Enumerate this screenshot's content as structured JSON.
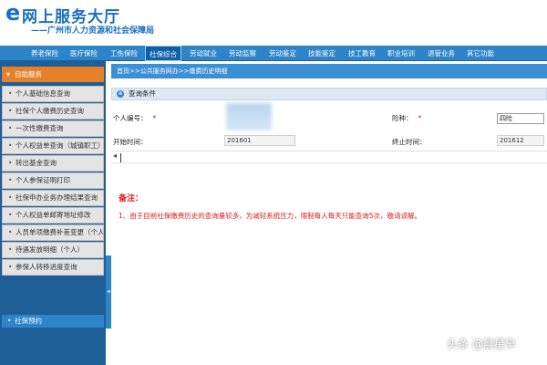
{
  "header": {
    "logo_letter": "e",
    "title": "网上服务大厅",
    "subtitle": "——广州市人力资源和社会保障局"
  },
  "nav": {
    "items": [
      "养老保险",
      "医疗保险",
      "工伤保险",
      "社保综合",
      "劳动就业",
      "劳动监察",
      "劳动鉴定",
      "技能鉴定",
      "技工教育",
      "职业培训",
      "退管业务",
      "其它功能"
    ],
    "active_index": 3
  },
  "sidebar": {
    "section": "自助服务",
    "items": [
      "个人基础信息查询",
      "社保个人缴费历史查询",
      "一次性缴费查询",
      "个人权益单查询（城镇职工）",
      "转出基金查询",
      "个人参保证明打印",
      "社保申办业务办理结果查询",
      "个人权益单邮寄地址修改",
      "人员单项缴费补差变更（个人）",
      "待遇发放明细（个人）",
      "参保人转移进度查询"
    ],
    "footer": "社保预约"
  },
  "main": {
    "breadcrumb": "首页>>公共服务网办>>缴费历史明细",
    "query_header": "查询条件",
    "form": {
      "person_no_label": "个人编号：",
      "required_mark": "*",
      "insurance_label": "险种：",
      "insurance_value": "四险",
      "start_label": "开始时间：",
      "start_value": "201601",
      "end_label": "终止时间：",
      "end_value": "201612"
    },
    "note_title": "备注：",
    "note_text": "1、由于目前社保缴费历史的查询量较多，为减轻系统压力，限制每人每天只能查询5次，敬请谅解。"
  },
  "watermark": "头条 @晨星早"
}
